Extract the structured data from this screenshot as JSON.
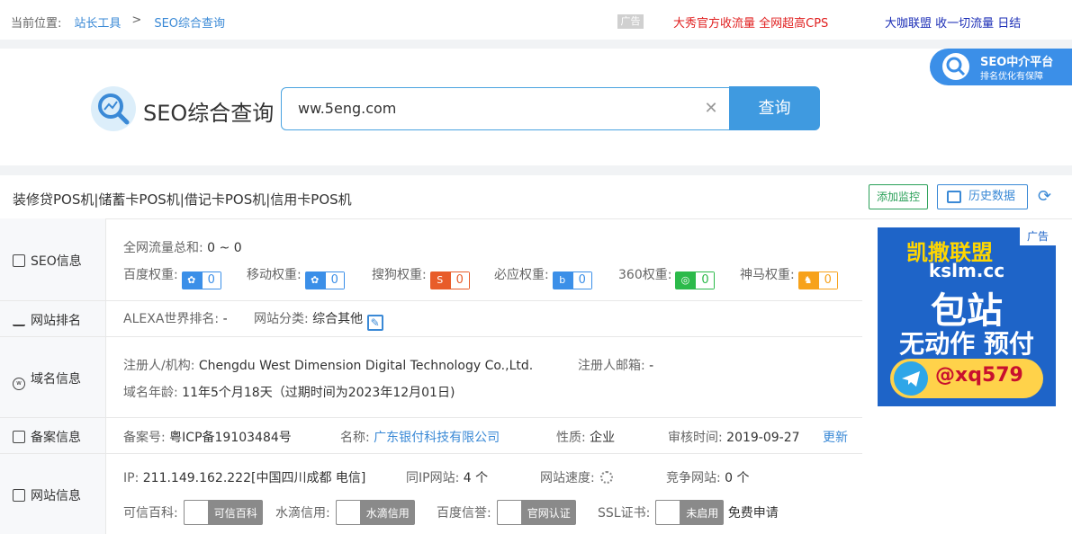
{
  "breadcrumb": {
    "label": "当前位置:",
    "items": [
      "站长工具",
      "SEO综合查询"
    ],
    "sep": ">"
  },
  "top_ads": {
    "tag": "广告",
    "ad1": "大秀官方收流量 全网超高CPS",
    "ad2": "大咖联盟 收一切流量 日结"
  },
  "search": {
    "title": "SEO综合查询",
    "query": "ww.5eng.com",
    "button": "查询",
    "clear_icon": "close-icon"
  },
  "badge": {
    "title": "SEO中介平台",
    "subtitle": "排名优化有保障"
  },
  "site": {
    "title": "装修贷POS机|储蓄卡POS机|借记卡POS机|信用卡POS机",
    "monitor_btn": "添加监控",
    "history_btn": "历史数据"
  },
  "seo": {
    "heading": "SEO信息",
    "traffic_label": "全网流量总和:",
    "traffic_value": "0 ~ 0",
    "weights": [
      {
        "label": "百度权重:",
        "value": "0",
        "color": "#3b8fe8"
      },
      {
        "label": "移动权重:",
        "value": "0",
        "color": "#3b8fe8"
      },
      {
        "label": "搜狗权重:",
        "value": "0",
        "color": "#e85c2a"
      },
      {
        "label": "必应权重:",
        "value": "0",
        "color": "#3b8fe8"
      },
      {
        "label": "360权重:",
        "value": "0",
        "color": "#2cba4a"
      },
      {
        "label": "神马权重:",
        "value": "0",
        "color": "#f7a21b"
      }
    ]
  },
  "rank": {
    "heading": "网站排名",
    "alexa_label": "ALEXA世界排名:",
    "alexa_value": "-",
    "cat_label": "网站分类:",
    "cat_value": "综合其他"
  },
  "domain": {
    "heading": "域名信息",
    "reg_label": "注册人/机构:",
    "reg_value": "Chengdu West Dimension Digital Technology Co.,Ltd.",
    "email_label": "注册人邮箱:",
    "email_value": "-",
    "age_label": "域名年龄:",
    "age_value": "11年5个月18天（过期时间为2023年12月01日)"
  },
  "icp": {
    "heading": "备案信息",
    "no_label": "备案号:",
    "no_value": "粤ICP备19103484号",
    "name_label": "名称:",
    "name_value": "广东银付科技有限公司",
    "type_label": "性质:",
    "type_value": "企业",
    "date_label": "审核时间:",
    "date_value": "2019-09-27",
    "update": "更新"
  },
  "info": {
    "heading": "网站信息",
    "ip_label": "IP:",
    "ip_value": "211.149.162.222[中国四川成都 电信]",
    "sameip_label": "同IP网站:",
    "sameip_value": "4 个",
    "speed_label": "网站速度:",
    "compete_label": "竞争网站:",
    "compete_value": "0 个",
    "kx_label": "可信百科:",
    "kx_value": "可信百科",
    "sd_label": "水滴信用:",
    "sd_value": "水滴信用",
    "bd_label": "百度信誉:",
    "bd_value": "官网认证",
    "ssl_label": "SSL证书:",
    "ssl_value": "未启用",
    "ssl_apply": "免费申请"
  },
  "side_ad": {
    "tag": "广告",
    "l1": "凯撒联盟",
    "l2": "kslm.cc",
    "l3": "包站",
    "l4": "无动作 预付",
    "contact": "@xq579"
  }
}
